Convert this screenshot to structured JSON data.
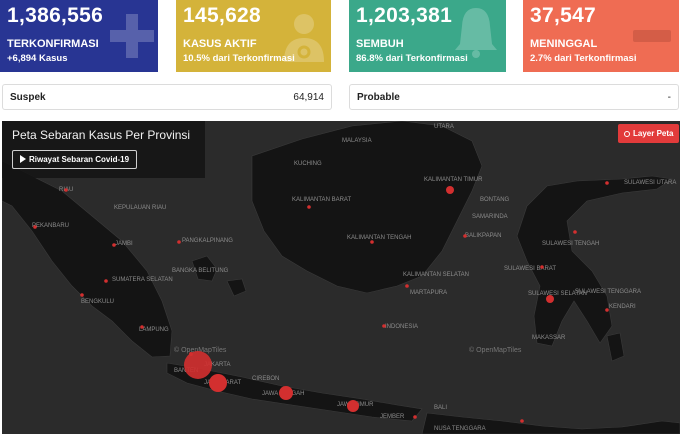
{
  "cards": {
    "confirmed": {
      "number": "1,386,556",
      "label": "TERKONFIRMASI",
      "sub": "+6,894 Kasus",
      "icon": "plus-icon",
      "color": "#283593"
    },
    "active": {
      "number": "145,628",
      "label": "KASUS AKTIF",
      "sub": "10.5% dari Terkonfirmasi",
      "icon": "doctor-icon",
      "color": "#d4b33a"
    },
    "recovered": {
      "number": "1,203,381",
      "label": "SEMBUH",
      "sub": "86.8% dari Terkonfirmasi",
      "icon": "bell-icon",
      "color": "#3ba88a"
    },
    "deaths": {
      "number": "37,547",
      "label": "MENINGGAL",
      "sub": "2.7% dari Terkonfirmasi",
      "icon": "minus-icon",
      "color": "#ef6c53"
    }
  },
  "stats": {
    "suspek": {
      "label": "Suspek",
      "value": "64,914"
    },
    "probable": {
      "label": "Probable",
      "value": "-"
    }
  },
  "map": {
    "title": "Peta Sebaran Kasus Per Provinsi",
    "history_button": "Riwayat Sebaran Covid-19",
    "layer_button": "Layer Peta",
    "credit_1": "© OpenMapTiles",
    "credit_2": "© OpenMapTiles",
    "labels": {
      "utara": "UTARA",
      "malaysia": "MALAYSIA",
      "kuching": "KUCHING",
      "riau": "RIAU",
      "kepulauan_riau": "KEPULAUAN RIAU",
      "kalimantan_barat": "KALIMANTAN BARAT",
      "kalimantan_timur": "KALIMANTAN TIMUR",
      "bontang": "BONTANG",
      "samarinda": "SAMARINDA",
      "balikpapan": "BALIKPAPAN",
      "kalimantan_tengah": "KALIMANTAN TENGAH",
      "kalimantan_selatan": "KALIMANTAN SELATAN",
      "martapura": "MARTAPURA",
      "pekanbaru": "PEKANBARU",
      "jambi": "JAMBI",
      "pangkalpinang": "PANGKALPINANG",
      "bangka_belitung": "BANGKA BELITUNG",
      "sumatera_selatan": "SUMATERA SELATAN",
      "bengkulu": "BENGKULU",
      "lampung": "LAMPUNG",
      "jakarta": "JAKARTA",
      "banten": "BANTEN",
      "jawa_barat": "JAWA BARAT",
      "cirebon": "CIREBON",
      "jawa_tengah": "JAWA TENGAH",
      "jawa_timur": "JAWA TIMUR",
      "indonesia": "INDONESIA",
      "sulawesi_utara": "SULAWESI UTARA",
      "sulawesi_tengah": "SULAWESI TENGAH",
      "sulawesi_barat": "SULAWESI BARAT",
      "sulawesi_selatan": "SULAWESI SELATAN",
      "sulawesi_tenggara": "SULAWESI TENGGARA",
      "kendari": "KENDARI",
      "makassar": "MAKASSAR",
      "bali": "BALI",
      "nusa_tenggara": "NUSA TENGGARA",
      "jember": "JEMBER"
    }
  }
}
